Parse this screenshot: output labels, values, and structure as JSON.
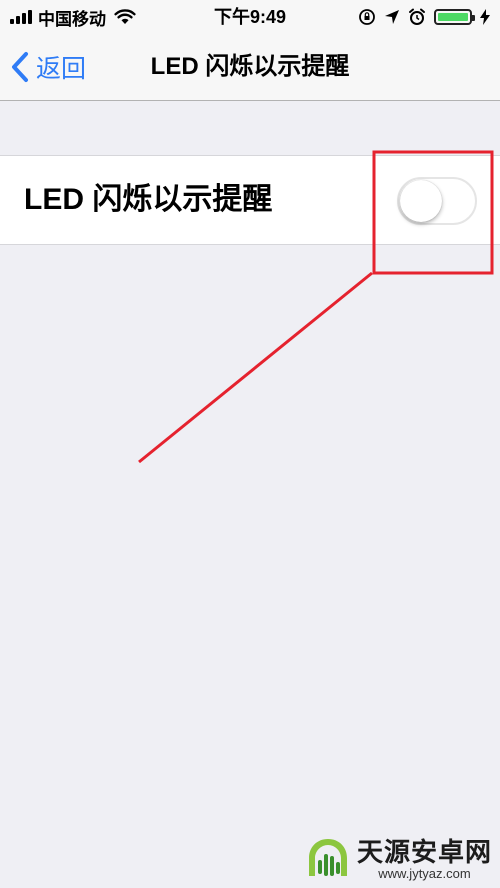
{
  "status_bar": {
    "carrier": "中国移动",
    "time": "下午9:49",
    "battery_color": "#4cd964"
  },
  "nav": {
    "back_label": "返回",
    "title": "LED 闪烁以示提醒"
  },
  "setting": {
    "label": "LED 闪烁以示提醒",
    "toggle_on": false
  },
  "annotation": {
    "color": "#e5222e"
  },
  "watermark": {
    "name": "天源安卓网",
    "url": "www.jytyaz.com"
  },
  "colors": {
    "accent": "#2f7cf6",
    "background": "#efeff4"
  }
}
